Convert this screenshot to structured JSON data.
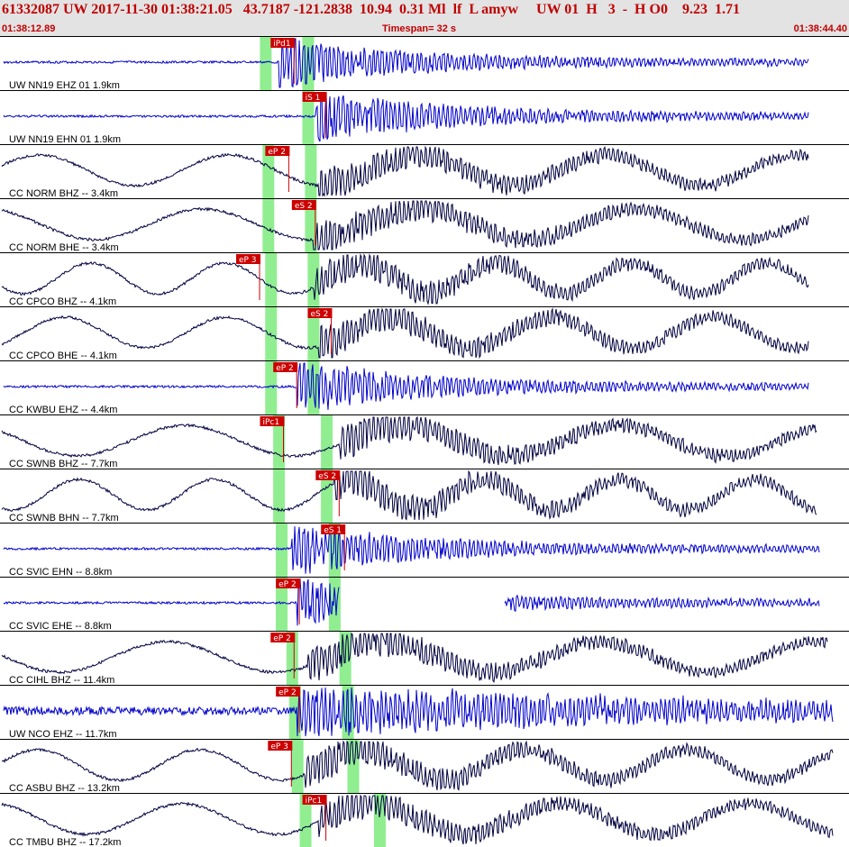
{
  "header": {
    "event_line": "61332087 UW 2017-11-30 01:38:21.05   43.7187 -121.2838  10.94  0.31 Ml  lf  L amyw     UW 01  H   3  -  H O0    9.23  1.71",
    "start_time": "01:38:12.89",
    "timespan": "Timespan=  32 s",
    "end_time": "01:38:44.40"
  },
  "colors": {
    "blue_trace": "#0000cc",
    "black_trace": "#000040",
    "pick": "#cc0000",
    "window": "#90ee90",
    "header_bg": "#e3e3e3",
    "header_text": "#c00000"
  },
  "chart_data": {
    "type": "line",
    "x_units": "seconds",
    "x_range": [
      0,
      32
    ],
    "traces": [
      {
        "label": "UW NN19 EHZ 01 1.9km",
        "color": "blue",
        "pick": "iPd1",
        "pick_t": 10.2,
        "p_window": 10.0,
        "s_window": 11.6,
        "onset": 10.5,
        "end": 30.5,
        "style": "quake"
      },
      {
        "label": "UW NN19 EHN 01 1.9km",
        "color": "blue",
        "pick": "iS 1",
        "pick_t": 11.4,
        "p_window": null,
        "s_window": 11.6,
        "onset": 11.9,
        "end": 30.5,
        "style": "quake"
      },
      {
        "label": "CC NORM BHZ -- 3.4km",
        "color": "black",
        "pick": "eP 2",
        "pick_t": 10.0,
        "p_window": 10.1,
        "s_window": 11.7,
        "onset": 12.0,
        "end": 30.5,
        "style": "slow"
      },
      {
        "label": "CC NORM BHE -- 3.4km",
        "color": "black",
        "pick": "eS 2",
        "pick_t": 11.0,
        "p_window": 10.1,
        "s_window": 11.7,
        "onset": 11.8,
        "end": 30.5,
        "style": "slow"
      },
      {
        "label": "CC CPCO BHZ -- 4.1km",
        "color": "black",
        "pick": "eP 3",
        "pick_t": 8.9,
        "p_window": 10.2,
        "s_window": 11.8,
        "onset": 11.8,
        "end": 30.5,
        "style": "slow"
      },
      {
        "label": "CC CPCO BHE -- 4.1km",
        "color": "black",
        "pick": "eS 2",
        "pick_t": 11.6,
        "p_window": 10.2,
        "s_window": 11.8,
        "onset": 12.0,
        "end": 30.5,
        "style": "slow"
      },
      {
        "label": "CC KWBU EHZ -- 4.4km",
        "color": "blue",
        "pick": "eP 2",
        "pick_t": 10.3,
        "p_window": 10.2,
        "s_window": 11.8,
        "onset": 11.2,
        "end": 30.5,
        "style": "quake"
      },
      {
        "label": "CC SWNB BHZ -- 7.7km",
        "color": "black",
        "pick": "iPc1",
        "pick_t": 9.8,
        "p_window": 10.5,
        "s_window": 12.3,
        "onset": 12.8,
        "end": 30.8,
        "style": "slow"
      },
      {
        "label": "CC SWNB BHN -- 7.7km",
        "color": "black",
        "pick": "eS 2",
        "pick_t": 11.9,
        "p_window": 10.5,
        "s_window": 12.3,
        "onset": 12.6,
        "end": 30.8,
        "style": "slow"
      },
      {
        "label": "CC SVIC EHN -- 8.8km",
        "color": "blue",
        "pick": "eS 1",
        "pick_t": 12.1,
        "p_window": 10.6,
        "s_window": 12.6,
        "onset": 11.0,
        "end": 30.9,
        "style": "quake"
      },
      {
        "label": "CC SVIC EHE -- 8.8km",
        "color": "blue",
        "pick": "eP 2",
        "pick_t": 10.4,
        "p_window": 10.6,
        "s_window": 12.6,
        "onset": 11.2,
        "end": 30.9,
        "style": "gap"
      },
      {
        "label": "CC CIHL BHZ -- 11.4km",
        "color": "black",
        "pick": "eP 2",
        "pick_t": 10.2,
        "p_window": 11.0,
        "s_window": 13.0,
        "onset": 11.6,
        "end": 31.2,
        "style": "slow"
      },
      {
        "label": "UW NCO EHZ -- 11.7km",
        "color": "blue",
        "pick": "eP 2",
        "pick_t": 10.4,
        "p_window": 11.1,
        "s_window": 13.1,
        "onset": 11.2,
        "end": 31.4,
        "style": "noisy"
      },
      {
        "label": "CC ASBU BHZ -- 13.2km",
        "color": "black",
        "pick": "eP 3",
        "pick_t": 10.1,
        "p_window": 11.2,
        "s_window": 13.3,
        "onset": 11.5,
        "end": 31.4,
        "style": "slow"
      },
      {
        "label": "CC TMBU BHZ -- 17.2km",
        "color": "black",
        "pick": "iPc1",
        "pick_t": 11.4,
        "p_window": 11.5,
        "s_window": 14.3,
        "onset": 12.0,
        "end": 31.4,
        "style": "slow"
      }
    ]
  }
}
